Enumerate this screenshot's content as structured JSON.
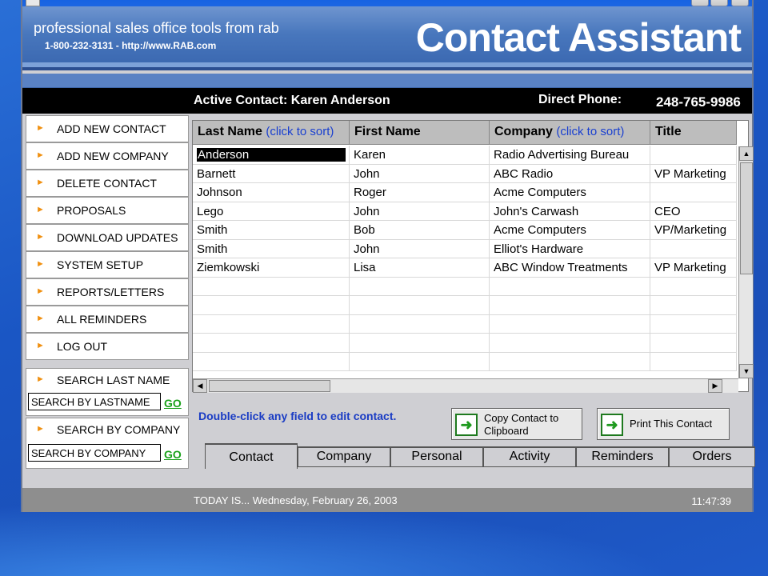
{
  "colors": {
    "accent_blue": "#1a3cc4",
    "go_green": "#1aa11a",
    "nav_arrow": "#f09010",
    "header_black": "#000000"
  },
  "banner": {
    "tagline": "professional sales office tools  from rab",
    "contact": "1-800-232-3131 - http://www.RAB.com",
    "product_title": "Contact Assistant"
  },
  "active_contact": {
    "label": "Active Contact:  Karen Anderson",
    "phone_label": "Direct Phone:",
    "phone": "248-765-9986"
  },
  "sidebar": {
    "items": [
      {
        "label": "ADD NEW CONTACT",
        "icon": "arrow-icon"
      },
      {
        "label": "ADD NEW COMPANY",
        "icon": "arrow-icon"
      },
      {
        "label": "DELETE CONTACT",
        "icon": "arrow-icon"
      },
      {
        "label": "PROPOSALS",
        "icon": "arrow-icon"
      },
      {
        "label": "DOWNLOAD UPDATES",
        "icon": "arrow-icon"
      },
      {
        "label": "SYSTEM SETUP",
        "icon": "arrow-icon"
      },
      {
        "label": "REPORTS/LETTERS",
        "icon": "arrow-icon"
      },
      {
        "label": "ALL REMINDERS",
        "icon": "arrow-icon"
      },
      {
        "label": "LOG OUT",
        "icon": "arrow-icon"
      }
    ],
    "search_last": {
      "title": "SEARCH LAST NAME",
      "value": "SEARCH BY LASTNAME",
      "go": "GO"
    },
    "search_company": {
      "title": "SEARCH BY COMPANY",
      "value": "SEARCH BY COMPANY",
      "go": "GO"
    }
  },
  "grid": {
    "columns": [
      {
        "name": "Last Name",
        "sort": "(click to sort)"
      },
      {
        "name": "First Name",
        "sort": ""
      },
      {
        "name": "Company",
        "sort": "(click to sort)"
      },
      {
        "name": "Title",
        "sort": ""
      }
    ],
    "rows": [
      [
        "Anderson",
        "Karen",
        "Radio Advertising Bureau",
        ""
      ],
      [
        "Barnett",
        "John",
        "ABC Radio",
        "VP Marketing"
      ],
      [
        "Johnson",
        "Roger",
        "Acme Computers",
        ""
      ],
      [
        "Lego",
        "John",
        "John's Carwash",
        "CEO"
      ],
      [
        "Smith",
        "Bob",
        "Acme Computers",
        "VP/Marketing"
      ],
      [
        "Smith",
        "John",
        "Elliot's Hardware",
        ""
      ],
      [
        "Ziemkowski",
        "Lisa",
        "ABC Window Treatments",
        "VP Marketing"
      ]
    ],
    "selected_row": 0
  },
  "footer_actions": {
    "hint": "Double-click any field to edit contact.",
    "copy_line1": "Copy  Contact to",
    "copy_line2": "Clipboard",
    "print_label": "Print This Contact"
  },
  "tabs": [
    "Contact",
    "Company",
    "Personal",
    "Activity",
    "Reminders",
    "Orders"
  ],
  "status": {
    "today": "TODAY IS...  Wednesday, February 26, 2003",
    "time": "11:47:39"
  }
}
